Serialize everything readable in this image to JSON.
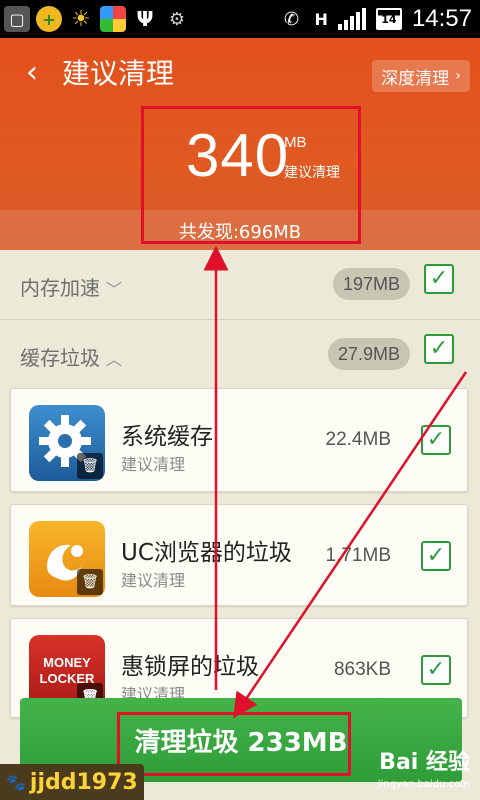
{
  "status_bar": {
    "time": "14:57",
    "battery": "14",
    "network": "H",
    "icons": [
      "sim-icon",
      "plus-app-icon",
      "weather-icon",
      "appstore-icon",
      "usb-icon",
      "android-debug-icon",
      "phone-call-icon"
    ]
  },
  "header": {
    "back_label": "‹",
    "title": "建议清理",
    "deep_clean_label": "深度清理",
    "suggested_amount": "340",
    "suggested_unit": "MB",
    "suggested_caption": "建议清理",
    "found_total": "共发现:696MB"
  },
  "sections": {
    "memory": {
      "label": "内存加速",
      "size": "197MB",
      "checked": true
    },
    "cache": {
      "label": "缓存垃圾",
      "size": "27.9MB",
      "checked": true
    }
  },
  "items": [
    {
      "title": "系统缓存",
      "subtitle": "建议清理",
      "size": "22.4MB",
      "checked": true
    },
    {
      "title": "UC浏览器的垃圾",
      "subtitle": "建议清理",
      "size": "1.71MB",
      "checked": true
    },
    {
      "title": "惠锁屏的垃圾",
      "subtitle": "建议清理",
      "size": "863KB",
      "checked": true
    }
  ],
  "clean_button_label": "清理垃圾 233MB",
  "watermarks": {
    "user": "jjdd1973",
    "baidu": "Bai 经验",
    "baidu_url": "jingyan.baidu.com"
  },
  "colors": {
    "header_orange": "#e3501c",
    "accent_green": "#2f9d38",
    "annotation_red": "#e0102a"
  }
}
